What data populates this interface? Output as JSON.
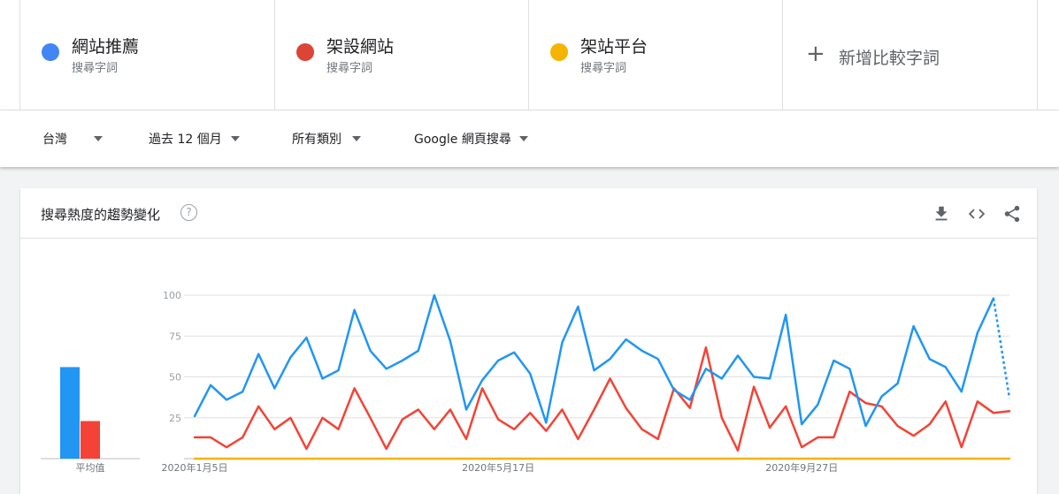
{
  "terms": [
    {
      "name": "網站推薦",
      "sub": "搜尋字詞",
      "color": "#4285f4"
    },
    {
      "name": "架設網站",
      "sub": "搜尋字詞",
      "color": "#db4437"
    },
    {
      "name": "架站平台",
      "sub": "搜尋字詞",
      "color": "#f4b400"
    }
  ],
  "add_term_label": "新增比較字詞",
  "filters": {
    "region": "台灣",
    "time": "過去 12 個月",
    "category": "所有類別",
    "property": "Google 網頁搜尋"
  },
  "card": {
    "title": "搜尋熱度的趨勢變化",
    "help": "?"
  },
  "averages_label": "平均值",
  "chart_data": {
    "type": "line",
    "x_labels": [
      "2020年1月5日",
      "2020年5月17日",
      "2020年9月27日"
    ],
    "y_ticks": [
      25,
      50,
      75,
      100
    ],
    "ylim": [
      0,
      100
    ],
    "series": [
      {
        "name": "網站推薦",
        "color": "#2196f3",
        "values": [
          26,
          45,
          36,
          41,
          64,
          43,
          62,
          74,
          49,
          54,
          91,
          66,
          55,
          60,
          66,
          100,
          72,
          30,
          48,
          60,
          65,
          52,
          22,
          71,
          93,
          54,
          61,
          73,
          66,
          61,
          42,
          36,
          55,
          49,
          63,
          50,
          49,
          88,
          21,
          33,
          60,
          55,
          20,
          38,
          46,
          81,
          61,
          56,
          41,
          77,
          98,
          37
        ],
        "partial_last": true
      },
      {
        "name": "架設網站",
        "color": "#f44336",
        "values": [
          13,
          13,
          7,
          13,
          32,
          18,
          25,
          6,
          25,
          18,
          43,
          25,
          6,
          24,
          30,
          18,
          30,
          12,
          43,
          24,
          18,
          28,
          17,
          30,
          12,
          30,
          49,
          31,
          18,
          12,
          43,
          31,
          68,
          25,
          5,
          44,
          19,
          32,
          7,
          13,
          13,
          41,
          34,
          32,
          20,
          14,
          21,
          35,
          7,
          35,
          28,
          29
        ],
        "partial_last": false
      },
      {
        "name": "架站平台",
        "color": "#f4b400",
        "values": [
          0,
          0,
          0,
          0,
          0,
          0,
          0,
          0,
          0,
          0,
          0,
          0,
          0,
          0,
          0,
          0,
          0,
          0,
          0,
          0,
          0,
          0,
          0,
          0,
          0,
          0,
          0,
          0,
          0,
          0,
          0,
          0,
          0,
          0,
          0,
          0,
          0,
          0,
          0,
          0,
          0,
          0,
          0,
          0,
          0,
          0,
          0,
          0,
          0,
          0,
          0,
          0
        ],
        "partial_last": false
      }
    ],
    "averages": [
      56,
      23,
      0
    ]
  }
}
